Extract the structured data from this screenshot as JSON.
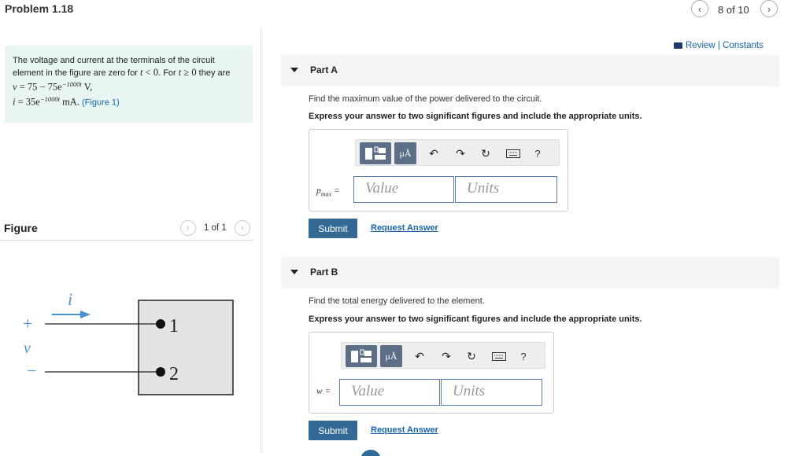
{
  "header": {
    "problem_title": "Problem 1.18",
    "prev_icon": "chevron-left",
    "next_icon": "chevron-right",
    "counter": "8 of 10"
  },
  "problem": {
    "intro": "The voltage and current at the terminals of the circuit element in the figure are zero for ",
    "t1": "t",
    "lt0": " < 0",
    "mid": ". For ",
    "t2": "t",
    "ge0": " ≥ 0",
    "they_are": " they are",
    "v_eq_prefix": "v",
    "v_eq_body": " = 75  −  75e",
    "v_exp": "−1000t",
    "v_unit": " V,",
    "i_eq_prefix": "i",
    "i_eq_body": " = 35e",
    "i_exp": "−1000t",
    "i_unit": " mA.",
    "figure_link": "(Figure 1)"
  },
  "figure": {
    "label": "Figure",
    "counter": "1 of 1",
    "plus": "+",
    "v_label": "v",
    "minus": "−",
    "i_label": "i",
    "terminal1": "1",
    "terminal2": "2"
  },
  "review": {
    "icon": "book-icon",
    "label": "Review | Constants"
  },
  "partA": {
    "title": "Part A",
    "prompt": "Find the maximum value of the power delivered to the circuit.",
    "instruction": "Express your answer to two significant figures and include the appropriate units.",
    "units_button": "μÅ",
    "help": "?",
    "var_main": "p",
    "var_sub": "max",
    "var_eq": " =",
    "value_placeholder": "Value",
    "units_placeholder": "Units",
    "submit": "Submit",
    "request": "Request Answer"
  },
  "partB": {
    "title": "Part B",
    "prompt": "Find the total energy delivered to the element.",
    "instruction": "Express your answer to two significant figures and include the appropriate units.",
    "units_button": "μÅ",
    "help": "?",
    "var_main": "w",
    "var_eq": " =",
    "value_placeholder": "Value",
    "units_placeholder": "Units",
    "submit": "Submit",
    "request": "Request Answer"
  },
  "colors": {
    "accent": "#326a95",
    "link": "#1565a8",
    "problem_bg": "#e9f5f3",
    "figure_blue": "#4a90d9"
  }
}
